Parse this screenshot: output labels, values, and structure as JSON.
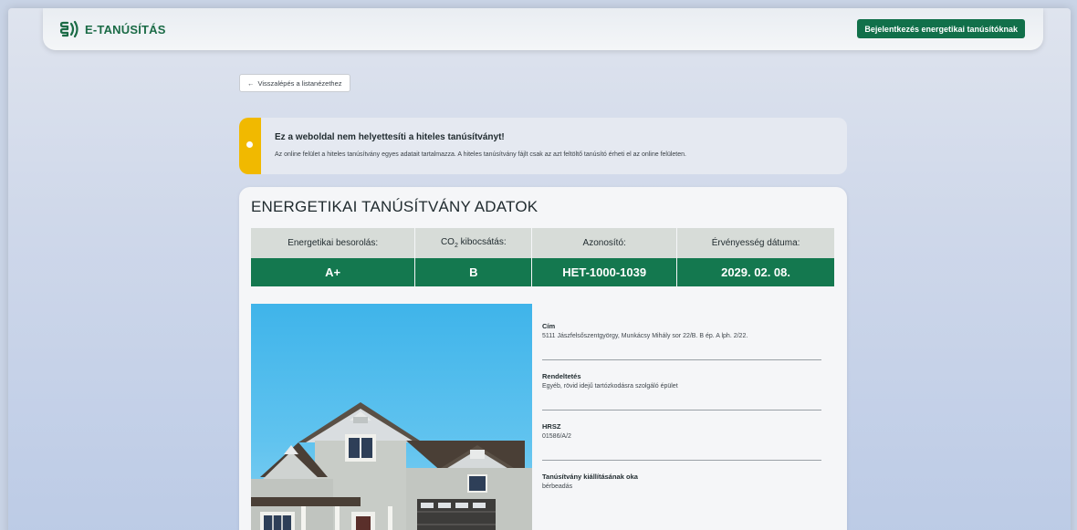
{
  "header": {
    "logo_text": "E-TANÚSÍTÁS",
    "login_button": "Bejelentkezés energetikai tanúsítóknak"
  },
  "back_button": {
    "label": "Visszalépés a listanézethez",
    "icon": "arrow-left-icon"
  },
  "notice": {
    "title": "Ez a weboldal nem helyettesíti a hiteles tanúsítványt!",
    "text": "Az online felület a hiteles tanúsítvány egyes adatait tartalmazza. A hiteles tanúsítvány fájlt csak az azt feltöltő tanúsító érheti el az online felületen.",
    "accent_color": "#f1b900"
  },
  "certificate": {
    "title": "ENERGETIKAI TANÚSÍTVÁNY ADATOK",
    "columns": [
      {
        "header": "Energetikai besorolás:",
        "value": "A+"
      },
      {
        "header_prefix": "CO",
        "header_sub": "2",
        "header_suffix": " kibocsátás:",
        "value": "B"
      },
      {
        "header": "Azonosító:",
        "value": "HET-1000-1039"
      },
      {
        "header": "Érvényesség dátuma:",
        "value": "2029. 02. 08."
      }
    ],
    "accent_color": "#14784f"
  },
  "details": [
    {
      "label": "Cím",
      "value": "5111 Jászfelsőszentgyörgy, Munkácsy Mihály sor 22/B. B ép. A lph. 2/22."
    },
    {
      "label": "Rendeltetés",
      "value": "Egyéb, rövid idejű tartózkodásra szolgáló épület"
    },
    {
      "label": "HRSZ",
      "value": "01586/A/2"
    },
    {
      "label": "Tanúsítvány kiállításának oka",
      "value": "bérbeadás"
    }
  ]
}
